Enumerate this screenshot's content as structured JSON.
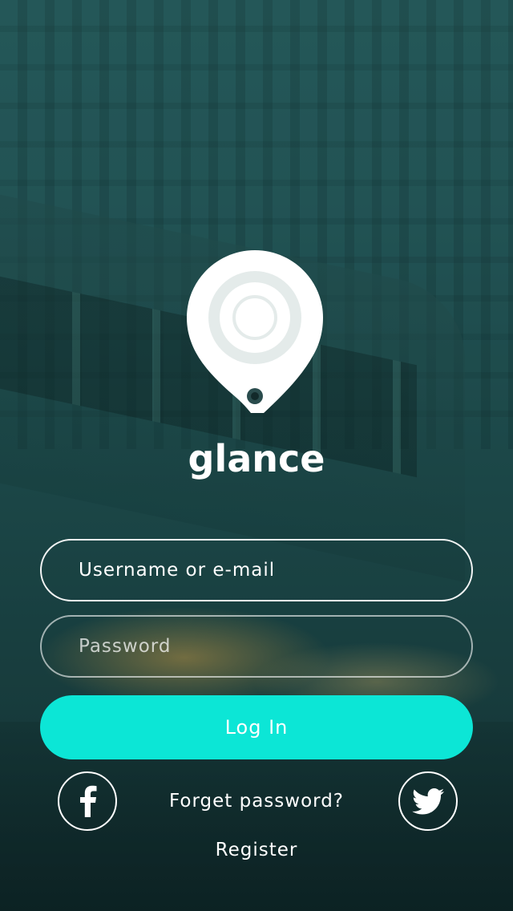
{
  "app": {
    "brand_name": "glance",
    "accent_color": "#0ce6d6"
  },
  "login_form": {
    "username_placeholder": "Username or e-mail",
    "username_value": "",
    "password_placeholder": "Password",
    "password_value": "",
    "login_label": "Log In"
  },
  "links": {
    "forgot_password": "Forget password?",
    "register": "Register"
  },
  "social": {
    "facebook_icon": "facebook-icon",
    "twitter_icon": "twitter-icon"
  }
}
